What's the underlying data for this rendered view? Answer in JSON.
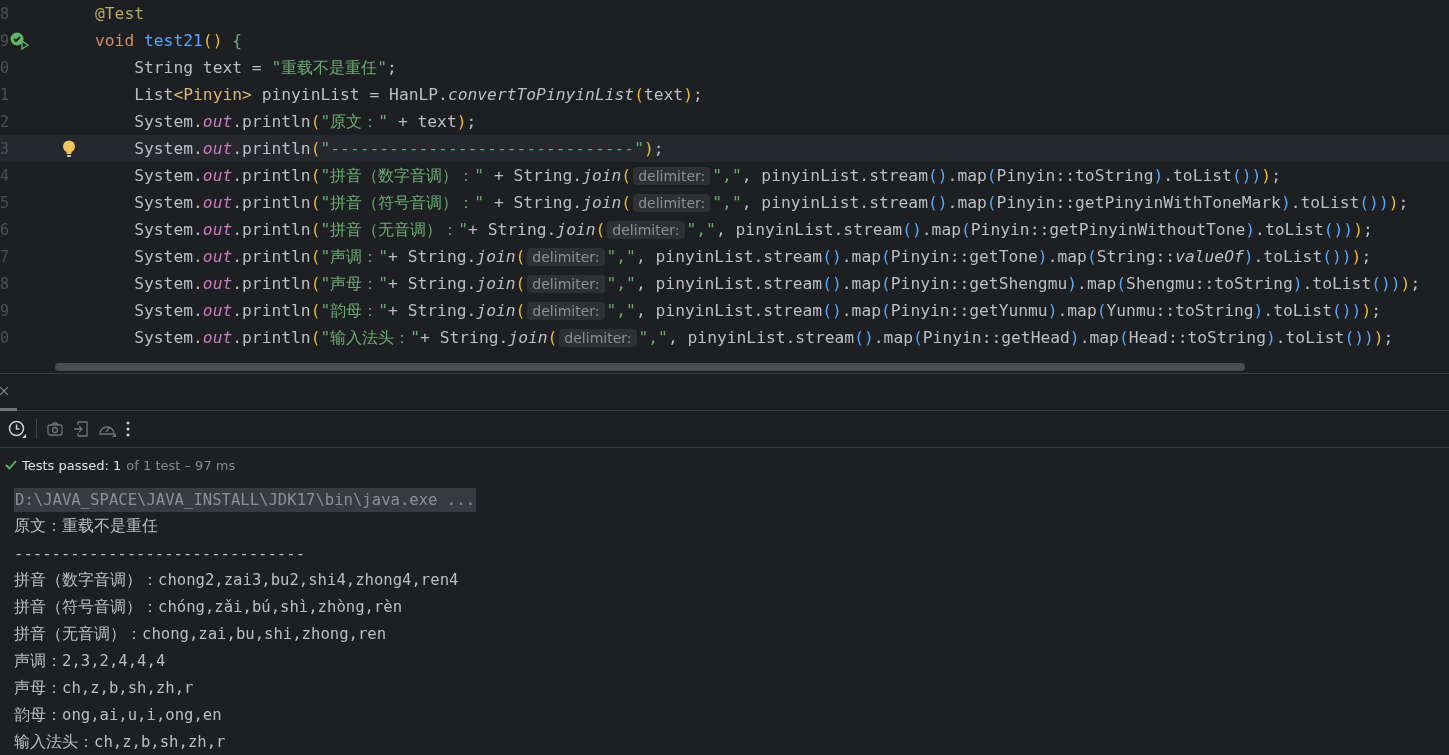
{
  "editor": {
    "lines": [
      {
        "number": "8",
        "current": false,
        "tokens": [
          {
            "kind": "annotation",
            "text": "@Test"
          }
        ]
      },
      {
        "number": "9",
        "current": false,
        "gutter": {
          "kind": "test-passed"
        },
        "tokens": [
          {
            "kind": "keyword",
            "text": "void "
          },
          {
            "kind": "decl",
            "text": "test21"
          },
          {
            "kind": "b1",
            "text": "()"
          },
          {
            "kind": "b2",
            "text": " {"
          }
        ]
      },
      {
        "number": "0",
        "current": false,
        "tokens": [
          {
            "kind": "plain",
            "text": "    String text = "
          },
          {
            "kind": "string",
            "text": "\"重载不是重任\""
          },
          {
            "kind": "plain",
            "text": ";"
          }
        ]
      },
      {
        "number": "1",
        "current": false,
        "tokens": [
          {
            "kind": "plain",
            "text": "    List"
          },
          {
            "kind": "generic",
            "text": "<Pinyin>"
          },
          {
            "kind": "plain",
            "text": " pinyinList = HanLP."
          },
          {
            "kind": "italic",
            "text": "convertToPinyinList"
          },
          {
            "kind": "b1",
            "text": "("
          },
          {
            "kind": "plain",
            "text": "text"
          },
          {
            "kind": "b1",
            "text": ")"
          },
          {
            "kind": "plain",
            "text": ";"
          }
        ]
      },
      {
        "number": "2",
        "current": false,
        "tokens": [
          {
            "kind": "plain",
            "text": "    System."
          },
          {
            "kind": "field",
            "text": "out"
          },
          {
            "kind": "plain",
            "text": ".println"
          },
          {
            "kind": "b1",
            "text": "("
          },
          {
            "kind": "string",
            "text": "\"原文：\""
          },
          {
            "kind": "plain",
            "text": " + text"
          },
          {
            "kind": "b1",
            "text": ")"
          },
          {
            "kind": "plain",
            "text": ";"
          }
        ]
      },
      {
        "number": "3",
        "current": true,
        "gutter": {
          "kind": "bulb"
        },
        "tokens": [
          {
            "kind": "plain",
            "text": "    System."
          },
          {
            "kind": "field",
            "text": "out"
          },
          {
            "kind": "plain",
            "text": ".println"
          },
          {
            "kind": "b1",
            "text": "("
          },
          {
            "kind": "string",
            "text": "\"-------------------------------\""
          },
          {
            "kind": "b1",
            "text": ")"
          },
          {
            "kind": "plain",
            "text": ";"
          }
        ]
      },
      {
        "number": "4",
        "current": false,
        "tokens": [
          {
            "kind": "plain",
            "text": "    System."
          },
          {
            "kind": "field",
            "text": "out"
          },
          {
            "kind": "plain",
            "text": ".println"
          },
          {
            "kind": "b1",
            "text": "("
          },
          {
            "kind": "string",
            "text": "\"拼音（数字音调）：\""
          },
          {
            "kind": "plain",
            "text": " + String."
          },
          {
            "kind": "italic",
            "text": "join"
          },
          {
            "kind": "b1",
            "text": "("
          },
          {
            "kind": "hint",
            "text": "delimiter:"
          },
          {
            "kind": "string",
            "text": "\",\""
          },
          {
            "kind": "plain",
            "text": ", pinyinList.stream"
          },
          {
            "kind": "b3",
            "text": "()"
          },
          {
            "kind": "plain",
            "text": ".map"
          },
          {
            "kind": "b3",
            "text": "("
          },
          {
            "kind": "plain",
            "text": "Pinyin::toString"
          },
          {
            "kind": "b3",
            "text": ")"
          },
          {
            "kind": "plain",
            "text": ".toList"
          },
          {
            "kind": "b3",
            "text": "())"
          },
          {
            "kind": "b1",
            "text": ")"
          },
          {
            "kind": "plain",
            "text": ";"
          }
        ]
      },
      {
        "number": "5",
        "current": false,
        "tokens": [
          {
            "kind": "plain",
            "text": "    System."
          },
          {
            "kind": "field",
            "text": "out"
          },
          {
            "kind": "plain",
            "text": ".println"
          },
          {
            "kind": "b1",
            "text": "("
          },
          {
            "kind": "string",
            "text": "\"拼音（符号音调）：\""
          },
          {
            "kind": "plain",
            "text": " + String."
          },
          {
            "kind": "italic",
            "text": "join"
          },
          {
            "kind": "b1",
            "text": "("
          },
          {
            "kind": "hint",
            "text": "delimiter:"
          },
          {
            "kind": "string",
            "text": "\",\""
          },
          {
            "kind": "plain",
            "text": ", pinyinList.stream"
          },
          {
            "kind": "b3",
            "text": "()"
          },
          {
            "kind": "plain",
            "text": ".map"
          },
          {
            "kind": "b3",
            "text": "("
          },
          {
            "kind": "plain",
            "text": "Pinyin::getPinyinWithToneMark"
          },
          {
            "kind": "b3",
            "text": ")"
          },
          {
            "kind": "plain",
            "text": ".toList"
          },
          {
            "kind": "b3",
            "text": "())"
          },
          {
            "kind": "b1",
            "text": ")"
          },
          {
            "kind": "plain",
            "text": ";"
          }
        ]
      },
      {
        "number": "6",
        "current": false,
        "tokens": [
          {
            "kind": "plain",
            "text": "    System."
          },
          {
            "kind": "field",
            "text": "out"
          },
          {
            "kind": "plain",
            "text": ".println"
          },
          {
            "kind": "b1",
            "text": "("
          },
          {
            "kind": "string",
            "text": "\"拼音（无音调）：\""
          },
          {
            "kind": "plain",
            "text": "+ String."
          },
          {
            "kind": "italic",
            "text": "join"
          },
          {
            "kind": "b1",
            "text": "("
          },
          {
            "kind": "hint",
            "text": "delimiter:"
          },
          {
            "kind": "string",
            "text": "\",\""
          },
          {
            "kind": "plain",
            "text": ", pinyinList.stream"
          },
          {
            "kind": "b3",
            "text": "()"
          },
          {
            "kind": "plain",
            "text": ".map"
          },
          {
            "kind": "b3",
            "text": "("
          },
          {
            "kind": "plain",
            "text": "Pinyin::getPinyinWithoutTone"
          },
          {
            "kind": "b3",
            "text": ")"
          },
          {
            "kind": "plain",
            "text": ".toList"
          },
          {
            "kind": "b3",
            "text": "())"
          },
          {
            "kind": "b1",
            "text": ")"
          },
          {
            "kind": "plain",
            "text": ";"
          }
        ]
      },
      {
        "number": "7",
        "current": false,
        "tokens": [
          {
            "kind": "plain",
            "text": "    System."
          },
          {
            "kind": "field",
            "text": "out"
          },
          {
            "kind": "plain",
            "text": ".println"
          },
          {
            "kind": "b1",
            "text": "("
          },
          {
            "kind": "string",
            "text": "\"声调：\""
          },
          {
            "kind": "plain",
            "text": "+ String."
          },
          {
            "kind": "italic",
            "text": "join"
          },
          {
            "kind": "b1",
            "text": "("
          },
          {
            "kind": "hint",
            "text": "delimiter:"
          },
          {
            "kind": "string",
            "text": "\",\""
          },
          {
            "kind": "plain",
            "text": ", pinyinList.stream"
          },
          {
            "kind": "b3",
            "text": "()"
          },
          {
            "kind": "plain",
            "text": ".map"
          },
          {
            "kind": "b3",
            "text": "("
          },
          {
            "kind": "plain",
            "text": "Pinyin::getTone"
          },
          {
            "kind": "b3",
            "text": ")"
          },
          {
            "kind": "plain",
            "text": ".map"
          },
          {
            "kind": "b3",
            "text": "("
          },
          {
            "kind": "plain",
            "text": "String::"
          },
          {
            "kind": "italic",
            "text": "valueOf"
          },
          {
            "kind": "b3",
            "text": ")"
          },
          {
            "kind": "plain",
            "text": ".toList"
          },
          {
            "kind": "b3",
            "text": "())"
          },
          {
            "kind": "b1",
            "text": ")"
          },
          {
            "kind": "plain",
            "text": ";"
          }
        ]
      },
      {
        "number": "8",
        "current": false,
        "tokens": [
          {
            "kind": "plain",
            "text": "    System."
          },
          {
            "kind": "field",
            "text": "out"
          },
          {
            "kind": "plain",
            "text": ".println"
          },
          {
            "kind": "b1",
            "text": "("
          },
          {
            "kind": "string",
            "text": "\"声母：\""
          },
          {
            "kind": "plain",
            "text": "+ String."
          },
          {
            "kind": "italic",
            "text": "join"
          },
          {
            "kind": "b1",
            "text": "("
          },
          {
            "kind": "hint",
            "text": "delimiter:"
          },
          {
            "kind": "string",
            "text": "\",\""
          },
          {
            "kind": "plain",
            "text": ", pinyinList.stream"
          },
          {
            "kind": "b3",
            "text": "()"
          },
          {
            "kind": "plain",
            "text": ".map"
          },
          {
            "kind": "b3",
            "text": "("
          },
          {
            "kind": "plain",
            "text": "Pinyin::getShengmu"
          },
          {
            "kind": "b3",
            "text": ")"
          },
          {
            "kind": "plain",
            "text": ".map"
          },
          {
            "kind": "b3",
            "text": "("
          },
          {
            "kind": "plain",
            "text": "Shengmu::toString"
          },
          {
            "kind": "b3",
            "text": ")"
          },
          {
            "kind": "plain",
            "text": ".toList"
          },
          {
            "kind": "b3",
            "text": "())"
          },
          {
            "kind": "b1",
            "text": ")"
          },
          {
            "kind": "plain",
            "text": ";"
          }
        ]
      },
      {
        "number": "9",
        "current": false,
        "tokens": [
          {
            "kind": "plain",
            "text": "    System."
          },
          {
            "kind": "field",
            "text": "out"
          },
          {
            "kind": "plain",
            "text": ".println"
          },
          {
            "kind": "b1",
            "text": "("
          },
          {
            "kind": "string",
            "text": "\"韵母：\""
          },
          {
            "kind": "plain",
            "text": "+ String."
          },
          {
            "kind": "italic",
            "text": "join"
          },
          {
            "kind": "b1",
            "text": "("
          },
          {
            "kind": "hint",
            "text": "delimiter:"
          },
          {
            "kind": "string",
            "text": "\",\""
          },
          {
            "kind": "plain",
            "text": ", pinyinList.stream"
          },
          {
            "kind": "b3",
            "text": "()"
          },
          {
            "kind": "plain",
            "text": ".map"
          },
          {
            "kind": "b3",
            "text": "("
          },
          {
            "kind": "plain",
            "text": "Pinyin::getYunmu"
          },
          {
            "kind": "b3",
            "text": ")"
          },
          {
            "kind": "plain",
            "text": ".map"
          },
          {
            "kind": "b3",
            "text": "("
          },
          {
            "kind": "plain",
            "text": "Yunmu::toString"
          },
          {
            "kind": "b3",
            "text": ")"
          },
          {
            "kind": "plain",
            "text": ".toList"
          },
          {
            "kind": "b3",
            "text": "())"
          },
          {
            "kind": "b1",
            "text": ")"
          },
          {
            "kind": "plain",
            "text": ";"
          }
        ]
      },
      {
        "number": "0",
        "current": false,
        "tokens": [
          {
            "kind": "plain",
            "text": "    System."
          },
          {
            "kind": "field",
            "text": "out"
          },
          {
            "kind": "plain",
            "text": ".println"
          },
          {
            "kind": "b1",
            "text": "("
          },
          {
            "kind": "string",
            "text": "\"输入法头：\""
          },
          {
            "kind": "plain",
            "text": "+ String."
          },
          {
            "kind": "italic",
            "text": "join"
          },
          {
            "kind": "b1",
            "text": "("
          },
          {
            "kind": "hint",
            "text": "delimiter:"
          },
          {
            "kind": "string",
            "text": "\",\""
          },
          {
            "kind": "plain",
            "text": ", pinyinList.stream"
          },
          {
            "kind": "b3",
            "text": "()"
          },
          {
            "kind": "plain",
            "text": ".map"
          },
          {
            "kind": "b3",
            "text": "("
          },
          {
            "kind": "plain",
            "text": "Pinyin::getHead"
          },
          {
            "kind": "b3",
            "text": ")"
          },
          {
            "kind": "plain",
            "text": ".map"
          },
          {
            "kind": "b3",
            "text": "("
          },
          {
            "kind": "plain",
            "text": "Head::toString"
          },
          {
            "kind": "b3",
            "text": ")"
          },
          {
            "kind": "plain",
            "text": ".toList"
          },
          {
            "kind": "b3",
            "text": "())"
          },
          {
            "kind": "b1",
            "text": ")"
          },
          {
            "kind": "plain",
            "text": ";"
          }
        ]
      }
    ]
  },
  "test_status": {
    "passed": "Tests passed: 1",
    "detail": "of 1 test – 97 ms"
  },
  "console": {
    "lines": [
      {
        "kind": "command",
        "text": "D:\\JAVA_SPACE\\JAVA_INSTALL\\JDK17\\bin\\java.exe ..."
      },
      {
        "kind": "output",
        "text": "原文：重载不是重任"
      },
      {
        "kind": "output",
        "text": "-------------------------------"
      },
      {
        "kind": "output",
        "text": "拼音（数字音调）：chong2,zai3,bu2,shi4,zhong4,ren4"
      },
      {
        "kind": "output",
        "text": "拼音（符号音调）：chóng,zǎi,bú,shì,zhòng,rèn"
      },
      {
        "kind": "output",
        "text": "拼音（无音调）：chong,zai,bu,shi,zhong,ren"
      },
      {
        "kind": "output",
        "text": "声调：2,3,2,4,4,4"
      },
      {
        "kind": "output",
        "text": "声母：ch,z,b,sh,zh,r"
      },
      {
        "kind": "output",
        "text": "韵母：ong,ai,u,i,ong,en"
      },
      {
        "kind": "output",
        "text": "输入法头：ch,z,b,sh,zh,r"
      }
    ]
  }
}
